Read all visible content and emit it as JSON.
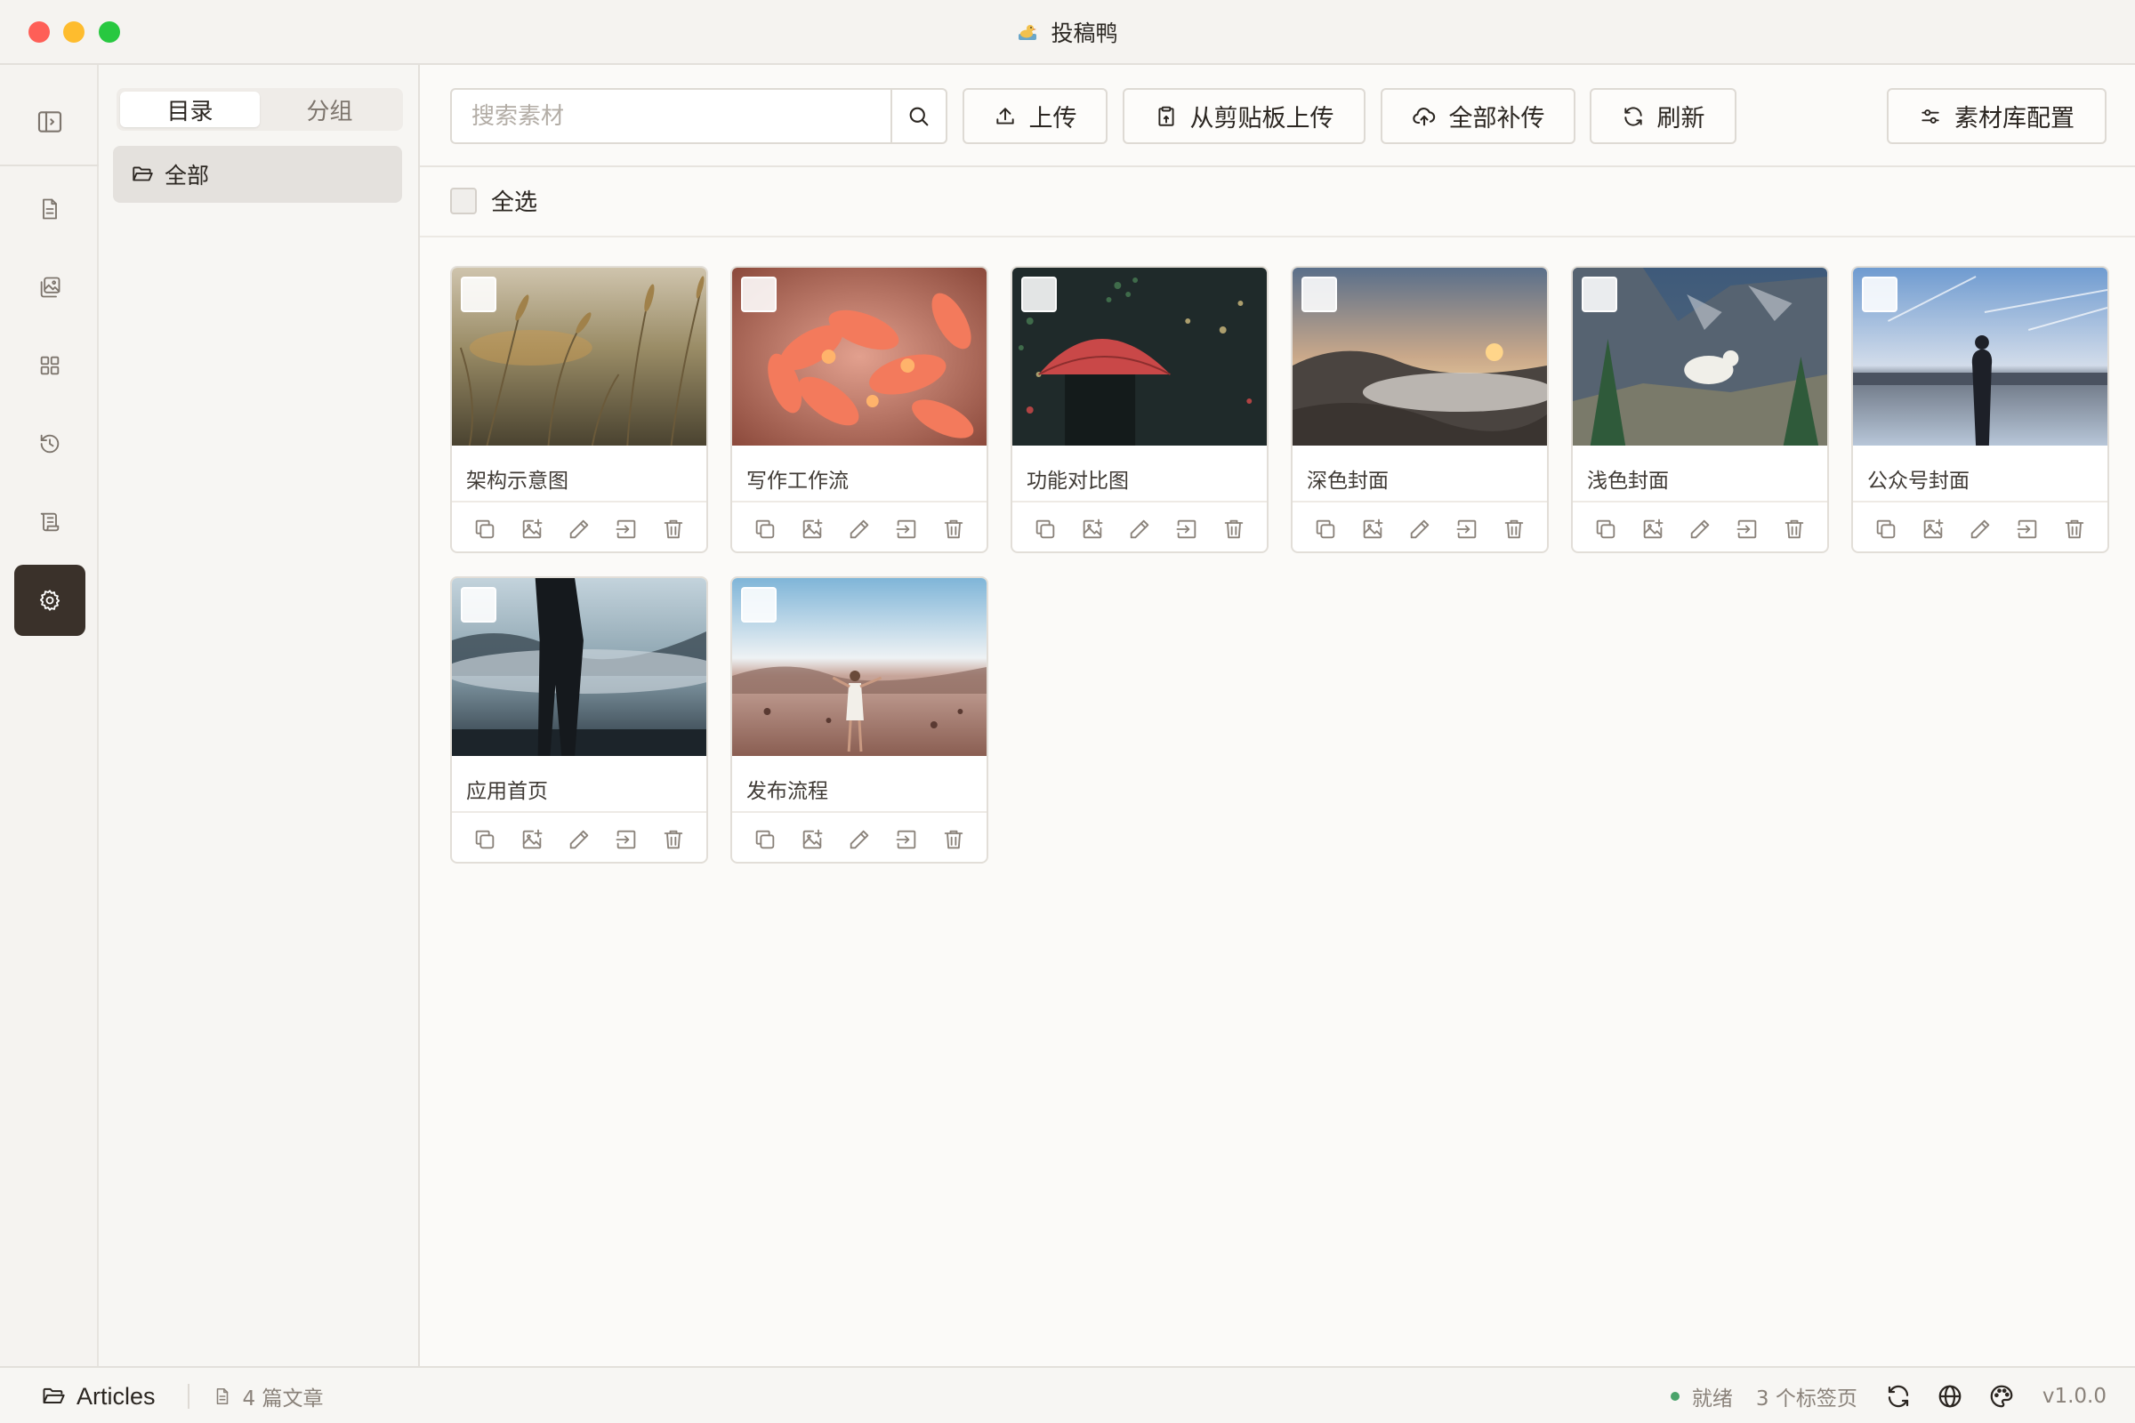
{
  "window": {
    "title": "投稿鸭",
    "logo_icon": "duck-logo-icon"
  },
  "rail": {
    "toggle_icon": "sidebar-toggle-icon",
    "items": [
      {
        "name": "articles",
        "icon": "document-icon",
        "active": false
      },
      {
        "name": "images",
        "icon": "image-library-icon",
        "active": false
      },
      {
        "name": "apps",
        "icon": "grid-icon",
        "active": false
      },
      {
        "name": "history",
        "icon": "history-icon",
        "active": false
      },
      {
        "name": "scroll",
        "icon": "scroll-icon",
        "active": false
      },
      {
        "name": "settings",
        "icon": "gear-icon",
        "active": true
      }
    ]
  },
  "directory": {
    "tabs": [
      {
        "label": "目录",
        "active": true
      },
      {
        "label": "分组",
        "active": false
      }
    ],
    "items": [
      {
        "label": "全部",
        "icon": "folder-open-icon",
        "selected": true
      }
    ]
  },
  "toolbar": {
    "search_placeholder": "搜索素材",
    "upload_label": "上传",
    "clipboard_upload_label": "从剪贴板上传",
    "reupload_all_label": "全部补传",
    "refresh_label": "刷新",
    "library_config_label": "素材库配置"
  },
  "select_all_label": "全选",
  "assets": [
    {
      "name": "架构示意图",
      "image": "wheat-field"
    },
    {
      "name": "写作工作流",
      "image": "orange-flowers"
    },
    {
      "name": "功能对比图",
      "image": "red-umbrella-night"
    },
    {
      "name": "深色封面",
      "image": "sunset-mountains"
    },
    {
      "name": "浅色封面",
      "image": "mountain-goat"
    },
    {
      "name": "公众号封面",
      "image": "man-lake-silhouette"
    },
    {
      "name": "应用首页",
      "image": "man-misty-shore"
    },
    {
      "name": "发布流程",
      "image": "woman-desert"
    }
  ],
  "card_actions": [
    {
      "name": "copy",
      "icon": "copy-icon"
    },
    {
      "name": "replace-image",
      "icon": "image-plus-icon"
    },
    {
      "name": "rename",
      "icon": "pencil-icon"
    },
    {
      "name": "move",
      "icon": "move-to-icon"
    },
    {
      "name": "delete",
      "icon": "trash-icon"
    }
  ],
  "statusbar": {
    "folder_label": "Articles",
    "article_count": "4 篇文章",
    "status": "就绪",
    "tab_count": "3 个标签页",
    "version": "v1.0.0",
    "status_color": "#4aa36a"
  }
}
